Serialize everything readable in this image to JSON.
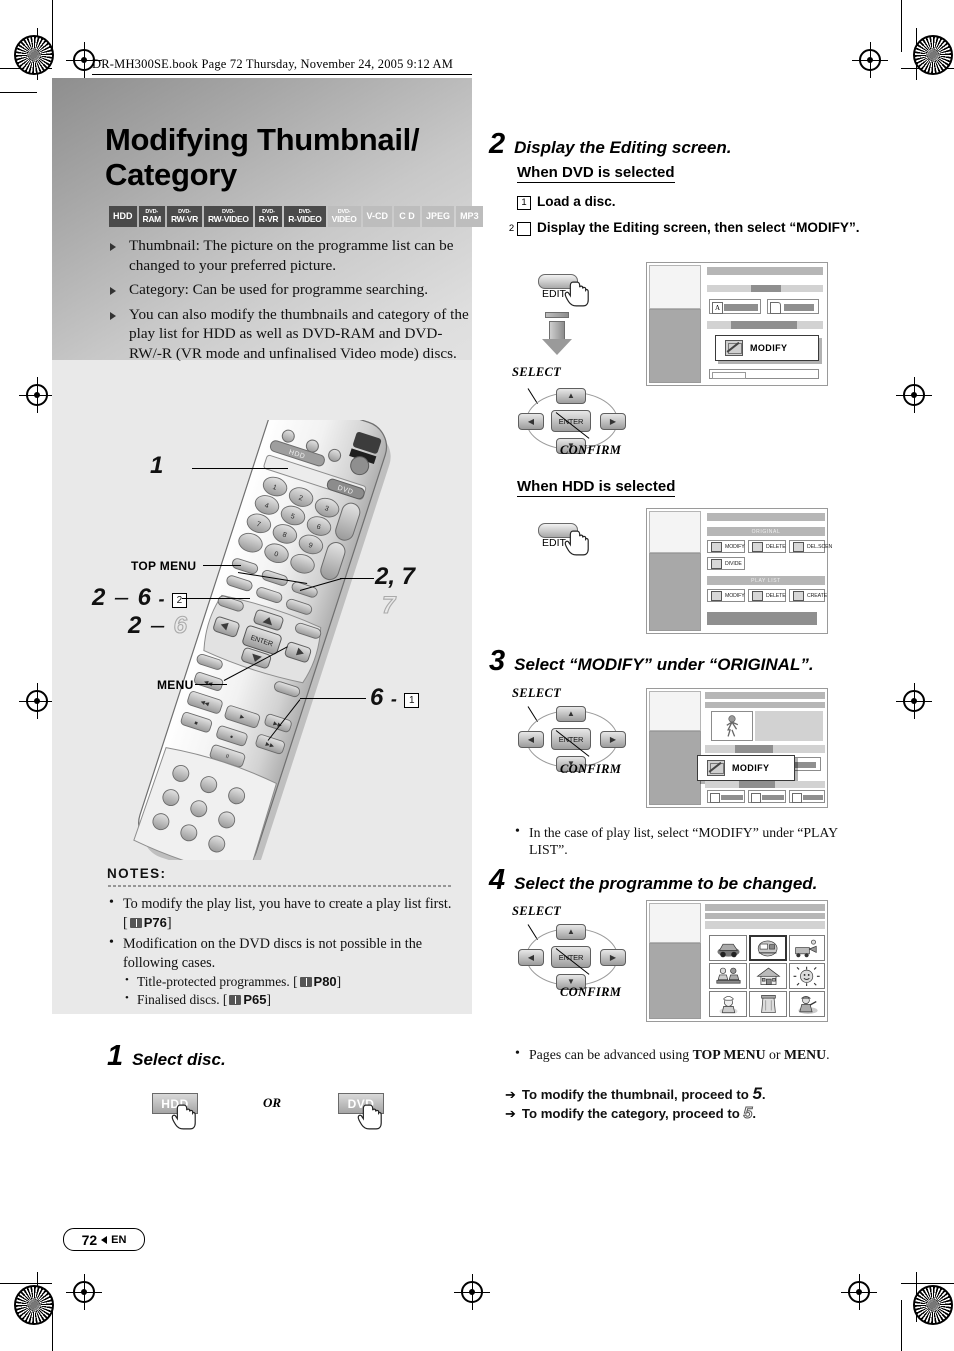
{
  "header": {
    "book_line": "DR-MH300SE.book  Page 72  Thursday, November 24, 2005  9:12 AM"
  },
  "title": "Modifying Thumbnail/ Category",
  "media_badges": [
    {
      "l1": "",
      "l2": "HDD",
      "active": true
    },
    {
      "l1": "DVD-",
      "l2": "RAM",
      "active": true
    },
    {
      "l1": "DVD-",
      "l2": "RW-VR",
      "active": true
    },
    {
      "l1": "DVD-",
      "l2": "RW-VIDEO",
      "active": true
    },
    {
      "l1": "DVD-",
      "l2": "R-VR",
      "active": true
    },
    {
      "l1": "DVD-",
      "l2": "R-VIDEO",
      "active": true
    },
    {
      "l1": "DVD-",
      "l2": "VIDEO",
      "active": false
    },
    {
      "l1": "",
      "l2": "V-CD",
      "active": false
    },
    {
      "l1": "",
      "l2": "C D",
      "active": false
    },
    {
      "l1": "",
      "l2": "JPEG",
      "active": false
    },
    {
      "l1": "",
      "l2": "MP3",
      "active": false
    }
  ],
  "intro_bullets": [
    "Thumbnail: The picture on the programme list can be changed to your preferred picture.",
    "Category: Can be used for programme searching.",
    "You can also modify the thumbnails and category of the play list for HDD as well as DVD-RAM and DVD-RW/-R (VR mode and unfinalised Video mode) discs."
  ],
  "remote": {
    "callout_1": "1",
    "callout_top_menu": "TOP MENU",
    "callout_menu": "MENU",
    "callout_2_7": "2, 7",
    "callout_7_outline": "7",
    "callout_2_6_a": "2",
    "callout_dash": "–",
    "callout_6": "6",
    "callout_box_2": "2",
    "callout_2_6_b": "2",
    "callout_6_outline": "6",
    "callout_6_b": "6",
    "callout_box_1": "1",
    "keys": {
      "hdd": "HDD",
      "dvd": "DVD",
      "enter": "ENTER"
    }
  },
  "notes": {
    "heading": "NOTES:",
    "items": [
      {
        "text_before": "To modify the play list, you have to create a play list first. [",
        "ref": "P76",
        "text_after": "]",
        "has_book": true
      },
      {
        "text_before": "Modification on the DVD discs is not possible in the following cases.",
        "ref": "",
        "text_after": "",
        "has_book": false
      }
    ],
    "subitems": [
      {
        "text_before": "Title-protected programmes. [",
        "ref": "P80",
        "text_after": "]"
      },
      {
        "text_before": "Finalised discs. [",
        "ref": "P65",
        "text_after": "]"
      }
    ]
  },
  "step1": {
    "num": "1",
    "title": "Select disc.",
    "btn_hdd": "HDD",
    "or": "OR",
    "btn_dvd": "DVD"
  },
  "step2": {
    "num": "2",
    "title": "Display the Editing screen.",
    "subhead_dvd": "When DVD is selected",
    "sub1_box": "1",
    "sub1_text": "Load a disc.",
    "sub2_box": "2",
    "sub2_text": "Display the Editing screen, then select “MODIFY”.",
    "subhead_hdd": "When HDD is selected",
    "edit_label": "EDIT",
    "select_label": "SELECT",
    "confirm_label": "CONFIRM",
    "enter_label": "ENTER",
    "dvd_screen": {
      "popup_label": "MODIFY"
    },
    "hdd_screen": {
      "section_original": "ORIGINAL",
      "original_items": [
        "MODIFY",
        "DELETE",
        "DEL.SCEN",
        "DIVIDE"
      ],
      "section_playlist": "PLAY LIST",
      "playlist_items": [
        "MODIFY",
        "DELETE",
        "CREATE"
      ]
    }
  },
  "step3": {
    "num": "3",
    "title": "Select “MODIFY” under “ORIGINAL”.",
    "select_label": "SELECT",
    "confirm_label": "CONFIRM",
    "enter_label": "ENTER",
    "popup_label": "MODIFY",
    "note": "In the case of play list, select “MODIFY” under “PLAY LIST”."
  },
  "step4": {
    "num": "4",
    "title": "Select the programme to be changed.",
    "select_label": "SELECT",
    "confirm_label": "CONFIRM",
    "enter_label": "ENTER",
    "note": "Pages can be advanced using TOP MENU or MENU.",
    "note_bold_1": "TOP MENU",
    "note_bold_2": "MENU",
    "arrow1_before": "To modify the thumbnail, proceed to ",
    "arrow1_num": "5",
    "arrow1_after": ".",
    "arrow2_before": "To modify the category, proceed to ",
    "arrow2_num": "5",
    "arrow2_after": "."
  },
  "footer": {
    "page_number": "72",
    "lang": "EN"
  },
  "colors": {
    "badge_on": "#4a4a4a",
    "badge_off": "#bdbdbd",
    "panel": "#e9e9e9",
    "screen_grey": "#a8a8a8"
  }
}
